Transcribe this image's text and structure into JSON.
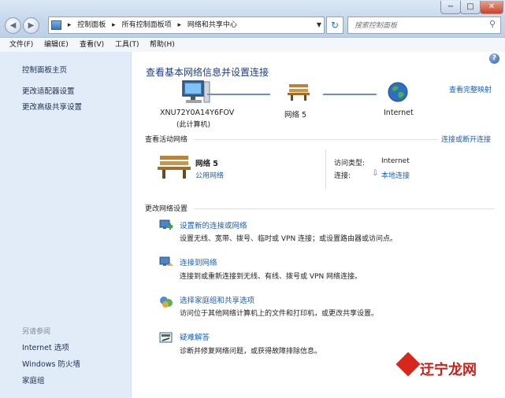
{
  "window": {
    "min_glyph": "−",
    "max_glyph": "□",
    "close_glyph": "✕"
  },
  "nav": {
    "back_glyph": "◀",
    "forward_glyph": "▶",
    "refresh_glyph": "↻"
  },
  "breadcrumb": [
    "控制面板",
    "所有控制面板项",
    "网络和共享中心"
  ],
  "search": {
    "placeholder": "搜索控制面板"
  },
  "menu": [
    "文件(F)",
    "编辑(E)",
    "查看(V)",
    "工具(T)",
    "帮助(H)"
  ],
  "sidebar": {
    "links": [
      "控制面板主页",
      "更改适配器设置",
      "更改高级共享设置"
    ],
    "see_also_heading": "另请参阅",
    "see_also": [
      "Internet 选项",
      "Windows 防火墙",
      "家庭组"
    ]
  },
  "main": {
    "title": "查看基本网络信息并设置连接",
    "full_map_link": "查看完整映射",
    "map": {
      "computer_name": "XNU72Y0A14Y6FOV",
      "computer_note": "(此计算机)",
      "network_label": "网络 5",
      "internet_label": "Internet"
    },
    "active_networks": {
      "heading": "查看活动网络",
      "connect_link": "连接或断开连接",
      "network_name": "网络 5",
      "network_type": "公用网络",
      "access_type_label": "访问类型:",
      "access_type_value": "Internet",
      "connection_label": "连接:",
      "connection_value": "本地连接"
    },
    "change_settings": {
      "heading": "更改网络设置",
      "tasks": [
        {
          "title": "设置新的连接或网络",
          "desc": "设置无线、宽带、拨号、临时或 VPN 连接；或设置路由器或访问点。",
          "icon": "new-connection-icon"
        },
        {
          "title": "连接到网络",
          "desc": "连接到或重新连接到无线、有线、拨号或 VPN 网络连接。",
          "icon": "connect-network-icon"
        },
        {
          "title": "选择家庭组和共享选项",
          "desc": "访问位于其他网络计算机上的文件和打印机，或更改共享设置。",
          "icon": "homegroup-icon"
        },
        {
          "title": "疑难解答",
          "desc": "诊断并修复网络问题，或获得故障排除信息。",
          "icon": "troubleshoot-icon"
        }
      ]
    }
  },
  "watermark": {
    "text": "迂宁龙网"
  },
  "colors": {
    "link": "#1b60b5",
    "title": "#1e3c84",
    "sidebar_bg": "#e2ecf8"
  }
}
